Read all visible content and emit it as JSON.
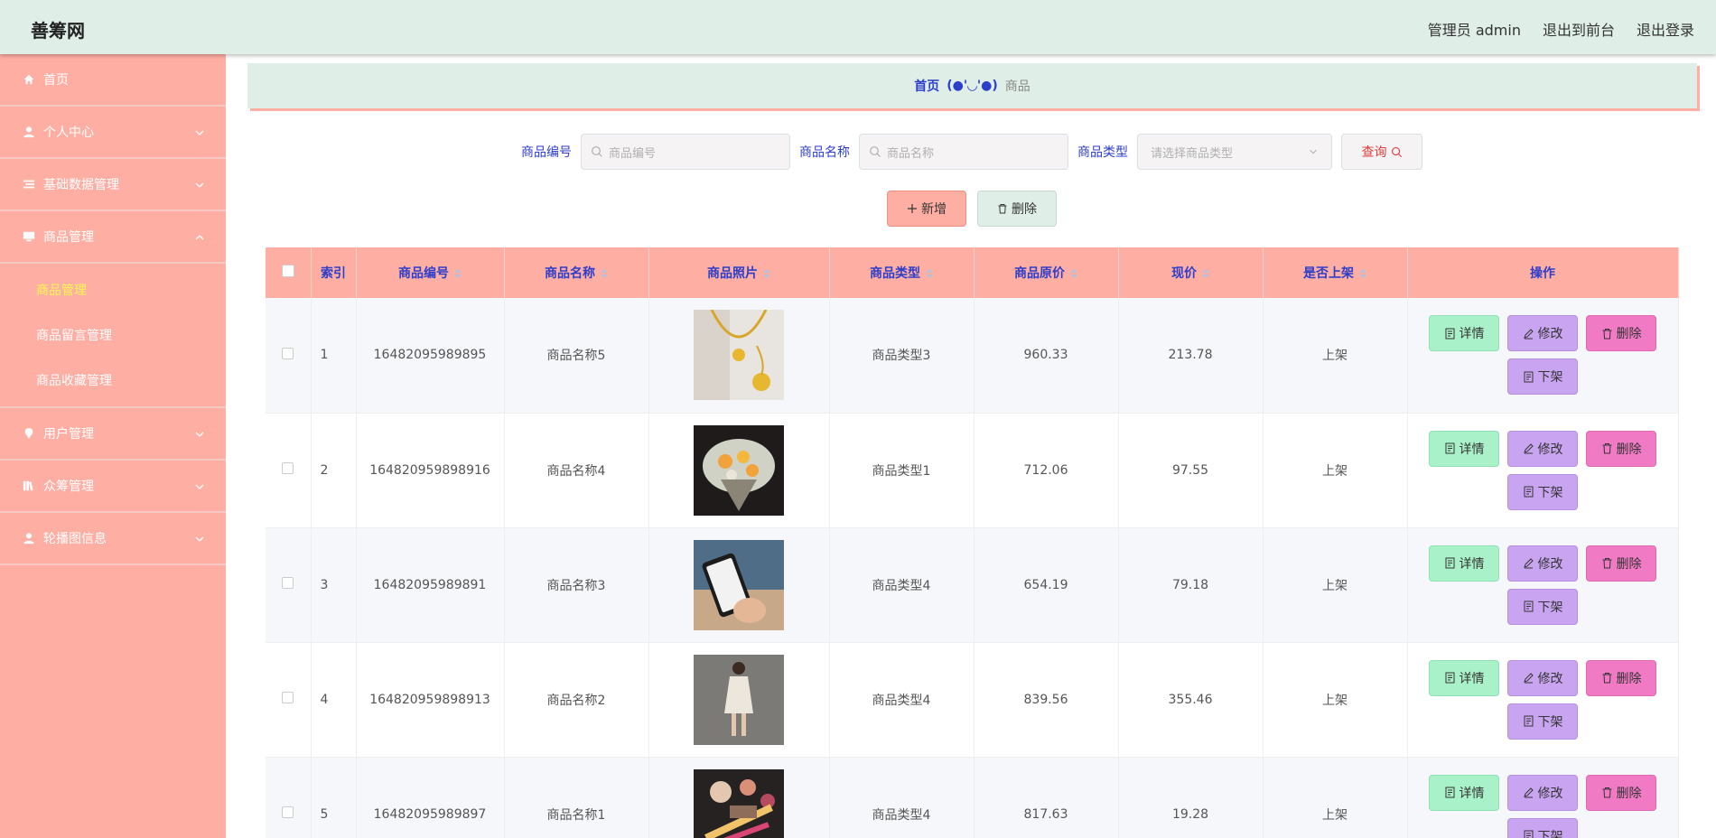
{
  "header": {
    "brand": "善筹网",
    "user": "管理员 admin",
    "to_front": "退出到前台",
    "logout": "退出登录"
  },
  "sidebar": {
    "items": [
      {
        "label": "首页",
        "icon": "home-icon"
      },
      {
        "label": "个人中心",
        "icon": "user-icon"
      },
      {
        "label": "基础数据管理",
        "icon": "list-icon"
      },
      {
        "label": "商品管理",
        "icon": "monitor-icon"
      },
      {
        "label": "用户管理",
        "icon": "location-icon"
      },
      {
        "label": "众筹管理",
        "icon": "books-icon"
      },
      {
        "label": "轮播图信息",
        "icon": "user-icon"
      }
    ],
    "sub_items": [
      "商品管理",
      "商品留言管理",
      "商品收藏管理"
    ]
  },
  "breadcrumb": {
    "home": "首页",
    "separator": "(●'◡'●)",
    "current": "商品"
  },
  "search": {
    "code_label": "商品编号",
    "code_placeholder": "商品编号",
    "name_label": "商品名称",
    "name_placeholder": "商品名称",
    "type_label": "商品类型",
    "type_placeholder": "请选择商品类型",
    "query_label": "查询"
  },
  "actions": {
    "add_label": "新增",
    "delete_label": "删除"
  },
  "table": {
    "headers": [
      "索引",
      "商品编号",
      "商品名称",
      "商品照片",
      "商品类型",
      "商品原价",
      "现价",
      "是否上架",
      "操作"
    ],
    "rows": [
      {
        "index": "1",
        "code": "16482095989895",
        "name": "商品名称5",
        "photo": "necklace",
        "type": "商品类型3",
        "price": "960.33",
        "now": "213.78",
        "status": "上架"
      },
      {
        "index": "2",
        "code": "164820959898916",
        "name": "商品名称4",
        "photo": "flowers",
        "type": "商品类型1",
        "price": "712.06",
        "now": "97.55",
        "status": "上架"
      },
      {
        "index": "3",
        "code": "16482095989891",
        "name": "商品名称3",
        "photo": "phone",
        "type": "商品类型4",
        "price": "654.19",
        "now": "79.18",
        "status": "上架"
      },
      {
        "index": "4",
        "code": "164820959898913",
        "name": "商品名称2",
        "photo": "dress",
        "type": "商品类型4",
        "price": "839.56",
        "now": "355.46",
        "status": "上架"
      },
      {
        "index": "5",
        "code": "16482095989897",
        "name": "商品名称1",
        "photo": "makeup",
        "type": "商品类型4",
        "price": "817.63",
        "now": "19.28",
        "status": "上架"
      }
    ],
    "op_labels": {
      "detail": "详情",
      "edit": "修改",
      "delete": "删除",
      "off_shelf": "下架"
    }
  },
  "colors": {
    "header_bg": "#dfeee7",
    "sidebar_bg": "#ffaea3",
    "accent_blue": "#2d3ecb",
    "active_sub": "#fff94f"
  }
}
